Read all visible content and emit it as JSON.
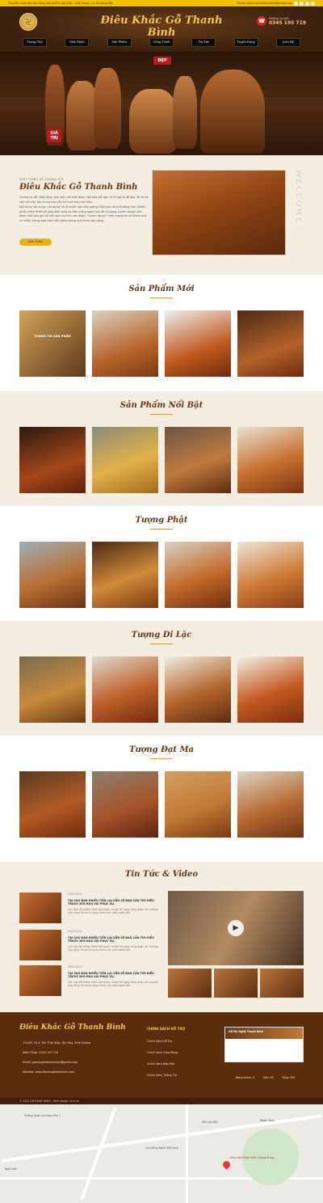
{
  "topbar": {
    "tagline": "Chuyên cung cấp các dòng sản phẩm, nội thất , chất lượng , uy tín hàng đầu",
    "email": "Email: gomynghethanhbinh@gmail.com"
  },
  "header": {
    "brand": "Điêu Khắc Gỗ Thanh Bình",
    "hotline_label": "Hotline tư vấn",
    "hotline_number": "0345 195 719"
  },
  "nav": [
    "Trang Chủ",
    "Giới Thiệu",
    "Sản Phẩm",
    "Công Trình",
    "Tin Tức",
    "Tuyển Dụng",
    "Liên Hệ"
  ],
  "hero": {
    "tag1": "ĐẸP",
    "tag2": "GIÁ TRỊ"
  },
  "intro": {
    "kicker": "GIỚI THIỆU VỀ CHÚNG TÔI",
    "heading": "Điêu Khắc Gỗ Thanh Bình",
    "paragraph1": "Chúng ta vẫn biết rằng, làm việc với một đoạn văn bản dễ đọc và rõ nghĩa dễ gây rối trí và cản trở việc tập trung vào yếu tố trình bày văn bản.",
    "paragraph2": "Nội dung nội dung, nội dung\" là rõ khiến văn bản giống thật hơn, bình thường hơn. Nhiều phần mềm thiết kế giao diện web và dàn trang ngày nay đã sử dụng Lorem Ipsum làm đoạn văn bản giả và nếu bạn thử tìm các đoạn \"Lorem Ipsum\" trên mạng thì sẽ khám phá ra nhiều trang web hiện vẫn đang trong quá trình xây dựng.",
    "button": "Xem Thêm",
    "side": "WELCOME"
  },
  "sections": [
    {
      "title": "Sản Phẩm Mới",
      "card_label": "THÔNG TIN SẢN PHẨM"
    },
    {
      "title": "Sản Phẩm Nổi Bật"
    },
    {
      "title": "Tượng Phật"
    },
    {
      "title": "Tượng Di Lặc"
    },
    {
      "title": "Tượng Đạt Ma"
    }
  ],
  "news": {
    "title": "Tin Tức & Video",
    "items": [
      {
        "date": "29/01/2021",
        "title": "TẠI SAO BẠN NHIỀU TIỀN LẠI VẪN SẼ BAN CẦN TÌM HIỂU TRƯỚC KHI MUA VẢI PHỤC VỤ.",
        "excerpt": "Các loại đồ thiêm nhân thợ quán, mướt tải ngày càng được ưa chuộng ứng rộng rãi và tỏ dung trong các mặt ngoài đối."
      },
      {
        "date": "29/01/2021",
        "title": "TẠI SAO BẠN NHIỀU TIỀN LẠI VẪN SẼ BAN CẦN TÌM HIỂU TRƯỚC KHI MUA VẢI PHỤC VỤ.",
        "excerpt": "Các loại đồ thiêm nhân thợ quán, mướt tải ngày càng được ưa chuộng ứng rộng rãi và tỏ dung trong các mặt ngoài đối."
      },
      {
        "date": "29/01/2021",
        "title": "TẠI SAO BẠN NHIỀU TIỀN LẠI VẪN SẼ BAN CẦN TÌM HIỂU TRƯỚC KHI MUA VẢI PHỤC VỤ.",
        "excerpt": "Các loại đồ thiêm nhân thợ quán, mướt tải ngày càng được ưa chuộng ứng rộng rãi và tỏ dung trong các mặt ngoài đối."
      }
    ]
  },
  "footer": {
    "brand": "Điêu Khắc Gỗ Thanh Bình",
    "address": "174/3F, Tổ 3, Tân Thới Hiệp, Tân Hòa, Bình Dương",
    "phone": "Điện Thoại: 0345 195 719",
    "email": "Email: gomynghethanhbinh@gmail.com",
    "website": "Website: www.dieuangthanhbinh.com",
    "policy_title": "CHÍNH SÁCH HỖ TRỢ",
    "policies": [
      "Chính Sách Hỗ Trợ",
      "Chính Sách Giao Hàng",
      "Chính Sách Bảo Mật",
      "Chính Sách Thông Tin"
    ],
    "fb_name": "Gỗ Mỹ Nghệ Thanh Bình",
    "stats": [
      "Đang online: 5",
      "Tuần: 95",
      "Tổng: 399"
    ],
    "copyright": "© 2021 VIETHANH BINH - Web design: vina.vn"
  },
  "map": {
    "labels": [
      "Trường Quân Sự Quân Khu 7",
      "Cao Đẳng Nghề Việt Nam",
      "Công viên Phần mềm Quang Trung",
      "Tòa nhà ASC",
      "Water Tank",
      "Ngõ Cafe"
    ]
  }
}
